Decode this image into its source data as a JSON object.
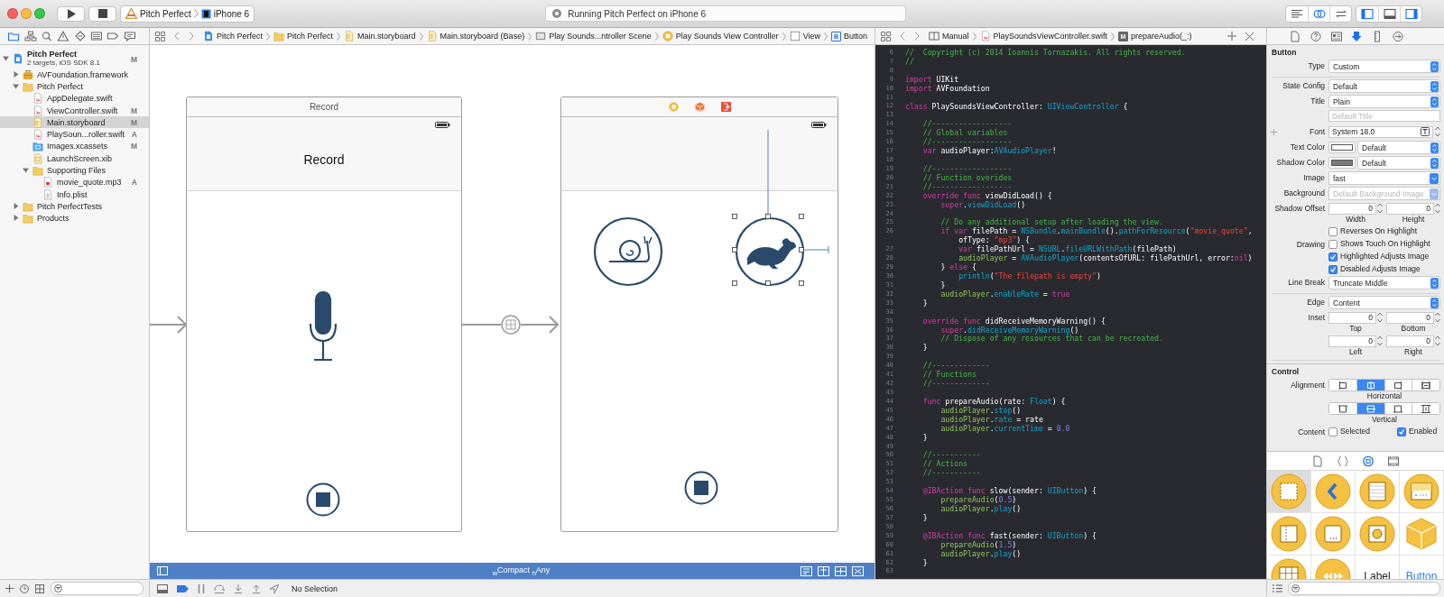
{
  "toolbar": {
    "scheme": {
      "target": "Pitch Perfect",
      "device": "iPhone 6"
    },
    "activity": "Running Pitch Perfect on iPhone 6",
    "editor_modes": [
      {
        "kind": "standard",
        "selected": false
      },
      {
        "kind": "assistant",
        "selected": true
      },
      {
        "kind": "version",
        "selected": false
      }
    ],
    "panels": [
      {
        "kind": "navigator",
        "on": true
      },
      {
        "kind": "debug",
        "on": false
      },
      {
        "kind": "utilities",
        "on": true
      }
    ]
  },
  "navigator": {
    "tabs": [
      {
        "kind": "project",
        "selected": true
      },
      {
        "kind": "symbols",
        "selected": false
      },
      {
        "kind": "search",
        "selected": false
      },
      {
        "kind": "issues",
        "selected": false
      },
      {
        "kind": "tests",
        "selected": false
      },
      {
        "kind": "debug",
        "selected": false
      },
      {
        "kind": "breakpoints",
        "selected": false
      },
      {
        "kind": "reports",
        "selected": false
      }
    ],
    "tree": [
      {
        "kind": "project",
        "name": "Pitch Perfect",
        "subtitle": "2 targets, iOS SDK 8.1",
        "badge": "M",
        "selected": false,
        "expanded": true,
        "children": [
          {
            "kind": "framework",
            "name": "AVFoundation.framework",
            "selected": false,
            "expanded": false
          },
          {
            "kind": "folder",
            "name": "Pitch Perfect",
            "selected": false,
            "expanded": true,
            "children": [
              {
                "kind": "swift",
                "name": "AppDelegate.swift",
                "selected": false
              },
              {
                "kind": "swift",
                "name": "ViewController.swift",
                "badge": "M",
                "selected": false
              },
              {
                "kind": "storyboard",
                "name": "Main.storyboard",
                "badge": "M",
                "selected": true
              },
              {
                "kind": "swift",
                "name": "PlaySoun...roller.swift",
                "badge": "A",
                "selected": false
              },
              {
                "kind": "assets",
                "name": "Images.xcassets",
                "badge": "M",
                "selected": false
              },
              {
                "kind": "xib",
                "name": "LaunchScreen.xib",
                "selected": false
              },
              {
                "kind": "folder",
                "name": "Supporting Files",
                "selected": false,
                "expanded": true,
                "children": [
                  {
                    "kind": "audio",
                    "name": "movie_quote.mp3",
                    "badge": "A",
                    "selected": false
                  },
                  {
                    "kind": "plist",
                    "name": "Info.plist",
                    "selected": false
                  }
                ]
              }
            ]
          },
          {
            "kind": "folder",
            "name": "Pitch PerfectTests",
            "selected": false,
            "expanded": false
          },
          {
            "kind": "folder",
            "name": "Products",
            "selected": false,
            "expanded": false
          }
        ]
      }
    ]
  },
  "jump_bar": {
    "crumbs": [
      {
        "kind": "project",
        "text": "Pitch Perfect"
      },
      {
        "kind": "folder",
        "text": "Pitch Perfect"
      },
      {
        "kind": "storyboard",
        "text": "Main.storyboard"
      },
      {
        "kind": "storyboard",
        "text": "Main.storyboard (Base)"
      },
      {
        "kind": "scene",
        "text": "Play Sounds...ntroller Scene"
      },
      {
        "kind": "controller",
        "text": "Play Sounds View Controller"
      },
      {
        "kind": "view",
        "text": "View"
      },
      {
        "kind": "letter",
        "icon_letter": "B",
        "text": "Button"
      }
    ]
  },
  "canvas": {
    "scenes": [
      {
        "kind": "record",
        "title": "Record",
        "nav_title": "Record",
        "buttons": [
          {
            "kind": "microphone",
            "selected": false
          },
          {
            "kind": "stop",
            "selected": false
          }
        ]
      },
      {
        "kind": "play",
        "buttons": [
          {
            "kind": "snail",
            "selected": false
          },
          {
            "kind": "rabbit",
            "selected": true
          },
          {
            "kind": "stop",
            "selected": false
          }
        ]
      }
    ],
    "size_class": "$_{w}$Compact $_{h}$Any"
  },
  "assistant": {
    "crumbs": [
      {
        "kind": "split",
        "text": "Manual"
      },
      {
        "kind": "swift",
        "text": "PlaySoundsViewController.swift"
      },
      {
        "kind": "letter",
        "icon_letter": "M",
        "text": "prepareAudio(_:)"
      }
    ],
    "code": [
      {
        "number": "6",
        "segments": [
          {
            "kind": "comment",
            "text": "//  Copyright (c) 2014 Ioannis Tornazakis. All rights reserved."
          }
        ]
      },
      {
        "number": "7",
        "segments": [
          {
            "kind": "comment",
            "text": "//"
          }
        ]
      },
      {
        "number": "8"
      },
      {
        "number": "9",
        "segments": [
          {
            "kind": "keyword",
            "text": "import"
          },
          {
            "kind": "plain",
            "text": " UIKit"
          }
        ]
      },
      {
        "number": "10",
        "segments": [
          {
            "kind": "keyword",
            "text": "import"
          },
          {
            "kind": "plain",
            "text": " AVFoundation"
          }
        ]
      },
      {
        "number": "11"
      },
      {
        "number": "12",
        "segments": [
          {
            "kind": "keyword",
            "text": "class"
          },
          {
            "kind": "plain",
            "text": " PlaySoundsViewController: "
          },
          {
            "kind": "api",
            "text": "UIViewController"
          },
          {
            "kind": "plain",
            "text": " {"
          }
        ]
      },
      {
        "number": "13"
      },
      {
        "number": "14",
        "segments": [
          {
            "kind": "comment",
            "text": "    //------------------"
          }
        ]
      },
      {
        "number": "15",
        "segments": [
          {
            "kind": "comment",
            "text": "    // Global variables"
          }
        ]
      },
      {
        "number": "16",
        "segments": [
          {
            "kind": "comment",
            "text": "    //------------------"
          }
        ]
      },
      {
        "number": "17",
        "segments": [
          {
            "kind": "keyword",
            "text": "    var"
          },
          {
            "kind": "plain",
            "text": " audioPlayer:"
          },
          {
            "kind": "api",
            "text": "AVAudioPlayer"
          },
          {
            "kind": "plain",
            "text": "!"
          }
        ]
      },
      {
        "number": "18"
      },
      {
        "number": "19",
        "segments": [
          {
            "kind": "comment",
            "text": "    //------------------"
          }
        ]
      },
      {
        "number": "20",
        "segments": [
          {
            "kind": "comment",
            "text": "    // Function overides"
          }
        ]
      },
      {
        "number": "21",
        "segments": [
          {
            "kind": "comment",
            "text": "    //------------------"
          }
        ]
      },
      {
        "number": "22",
        "segments": [
          {
            "kind": "keyword",
            "text": "    override func"
          },
          {
            "kind": "plain",
            "text": " viewDidLoad() {"
          }
        ]
      },
      {
        "number": "23",
        "segments": [
          {
            "kind": "keyword",
            "text": "        super"
          },
          {
            "kind": "plain",
            "text": "."
          },
          {
            "kind": "api",
            "text": "viewDidLoad"
          },
          {
            "kind": "plain",
            "text": "()"
          }
        ]
      },
      {
        "number": "24"
      },
      {
        "number": "25",
        "segments": [
          {
            "kind": "comment",
            "text": "        // Do any additional setup after loading the view."
          }
        ]
      },
      {
        "number": "26",
        "segments": [
          {
            "kind": "keyword",
            "text": "        if var"
          },
          {
            "kind": "plain",
            "text": " filePath = "
          },
          {
            "kind": "api",
            "text": "NSBundle"
          },
          {
            "kind": "plain",
            "text": "."
          },
          {
            "kind": "api",
            "text": "mainBundle"
          },
          {
            "kind": "plain",
            "text": "()."
          },
          {
            "kind": "api",
            "text": "pathForResource"
          },
          {
            "kind": "plain",
            "text": "("
          },
          {
            "kind": "string",
            "text": "\"movie_quote\""
          },
          {
            "kind": "plain",
            "text": ","
          }
        ]
      },
      {
        "segments": [
          {
            "kind": "plain",
            "text": "            ofType: "
          },
          {
            "kind": "string",
            "text": "\"mp3\""
          },
          {
            "kind": "plain",
            "text": ") {"
          }
        ]
      },
      {
        "number": "27",
        "segments": [
          {
            "kind": "keyword",
            "text": "            var"
          },
          {
            "kind": "plain",
            "text": " filePathUrl = "
          },
          {
            "kind": "api",
            "text": "NSURL"
          },
          {
            "kind": "plain",
            "text": "."
          },
          {
            "kind": "api",
            "text": "fileURLWithPath"
          },
          {
            "kind": "plain",
            "text": "(filePath)"
          }
        ]
      },
      {
        "number": "28",
        "segments": [
          {
            "kind": "project",
            "text": "            audioPlayer"
          },
          {
            "kind": "plain",
            "text": " = "
          },
          {
            "kind": "api",
            "text": "AVAudioPlayer"
          },
          {
            "kind": "plain",
            "text": "(contentsOfURL: filePathUrl, error:"
          },
          {
            "kind": "keyword",
            "text": "nil"
          },
          {
            "kind": "plain",
            "text": ")"
          }
        ]
      },
      {
        "number": "29",
        "segments": [
          {
            "kind": "plain",
            "text": "        } "
          },
          {
            "kind": "keyword",
            "text": "else"
          },
          {
            "kind": "plain",
            "text": " {"
          }
        ]
      },
      {
        "number": "30",
        "segments": [
          {
            "kind": "api",
            "text": "            println"
          },
          {
            "kind": "plain",
            "text": "("
          },
          {
            "kind": "string",
            "text": "\"The filepath is empty\""
          },
          {
            "kind": "plain",
            "text": ")"
          }
        ]
      },
      {
        "number": "31",
        "segments": [
          {
            "kind": "plain",
            "text": "        }"
          }
        ]
      },
      {
        "number": "32",
        "segments": [
          {
            "kind": "project",
            "text": "        audioPlayer"
          },
          {
            "kind": "plain",
            "text": "."
          },
          {
            "kind": "api",
            "text": "enableRate"
          },
          {
            "kind": "plain",
            "text": " = "
          },
          {
            "kind": "keyword",
            "text": "true"
          }
        ]
      },
      {
        "number": "33",
        "segments": [
          {
            "kind": "plain",
            "text": "    }"
          }
        ]
      },
      {
        "number": "34"
      },
      {
        "number": "35",
        "segments": [
          {
            "kind": "keyword",
            "text": "    override func"
          },
          {
            "kind": "plain",
            "text": " didReceiveMemoryWarning() {"
          }
        ]
      },
      {
        "number": "36",
        "segments": [
          {
            "kind": "keyword",
            "text": "        super"
          },
          {
            "kind": "plain",
            "text": "."
          },
          {
            "kind": "api",
            "text": "didReceiveMemoryWarning"
          },
          {
            "kind": "plain",
            "text": "()"
          }
        ]
      },
      {
        "number": "37",
        "segments": [
          {
            "kind": "comment",
            "text": "        // Dispose of any resources that can be recreated."
          }
        ]
      },
      {
        "number": "38",
        "segments": [
          {
            "kind": "plain",
            "text": "    }"
          }
        ]
      },
      {
        "number": "39"
      },
      {
        "number": "40",
        "segments": [
          {
            "kind": "comment",
            "text": "    //-------------"
          }
        ]
      },
      {
        "number": "41",
        "segments": [
          {
            "kind": "comment",
            "text": "    // Functions"
          }
        ]
      },
      {
        "number": "42",
        "segments": [
          {
            "kind": "comment",
            "text": "    //-------------"
          }
        ]
      },
      {
        "number": "43"
      },
      {
        "number": "44",
        "segments": [
          {
            "kind": "keyword",
            "text": "    func"
          },
          {
            "kind": "plain",
            "text": " prepareAudio(rate: "
          },
          {
            "kind": "api",
            "text": "Float"
          },
          {
            "kind": "plain",
            "text": ") {"
          }
        ]
      },
      {
        "number": "45",
        "segments": [
          {
            "kind": "project",
            "text": "        audioPlayer"
          },
          {
            "kind": "plain",
            "text": "."
          },
          {
            "kind": "api",
            "text": "stop"
          },
          {
            "kind": "plain",
            "text": "()"
          }
        ]
      },
      {
        "number": "46",
        "segments": [
          {
            "kind": "project",
            "text": "        audioPlayer"
          },
          {
            "kind": "plain",
            "text": "."
          },
          {
            "kind": "api",
            "text": "rate"
          },
          {
            "kind": "plain",
            "text": " = rate"
          }
        ]
      },
      {
        "number": "47",
        "segments": [
          {
            "kind": "project",
            "text": "        audioPlayer"
          },
          {
            "kind": "plain",
            "text": "."
          },
          {
            "kind": "api",
            "text": "currentTime"
          },
          {
            "kind": "plain",
            "text": " = "
          },
          {
            "kind": "number",
            "text": "0.0"
          }
        ]
      },
      {
        "number": "48",
        "segments": [
          {
            "kind": "plain",
            "text": "    }"
          }
        ]
      },
      {
        "number": "49"
      },
      {
        "number": "50",
        "segments": [
          {
            "kind": "comment",
            "text": "    //-----------"
          }
        ]
      },
      {
        "number": "51",
        "segments": [
          {
            "kind": "comment",
            "text": "    // Actions"
          }
        ]
      },
      {
        "number": "52",
        "segments": [
          {
            "kind": "comment",
            "text": "    //-----------"
          }
        ]
      },
      {
        "number": "53"
      },
      {
        "number": "54",
        "segments": [
          {
            "kind": "keyword",
            "text": "    @IBAction func"
          },
          {
            "kind": "plain",
            "text": " slow(sender: "
          },
          {
            "kind": "api",
            "text": "UIButton"
          },
          {
            "kind": "plain",
            "text": ") {"
          }
        ]
      },
      {
        "number": "55",
        "segments": [
          {
            "kind": "project",
            "text": "        prepareAudio"
          },
          {
            "kind": "plain",
            "text": "("
          },
          {
            "kind": "number",
            "text": "0.5"
          },
          {
            "kind": "plain",
            "text": ")"
          }
        ]
      },
      {
        "number": "56",
        "segments": [
          {
            "kind": "project",
            "text": "        audioPlayer"
          },
          {
            "kind": "plain",
            "text": "."
          },
          {
            "kind": "api",
            "text": "play"
          },
          {
            "kind": "plain",
            "text": "()"
          }
        ]
      },
      {
        "number": "57",
        "segments": [
          {
            "kind": "plain",
            "text": "    }"
          }
        ]
      },
      {
        "number": "58"
      },
      {
        "number": "59",
        "segments": [
          {
            "kind": "keyword",
            "text": "    @IBAction func"
          },
          {
            "kind": "plain",
            "text": " fast(sender: "
          },
          {
            "kind": "api",
            "text": "UIButton"
          },
          {
            "kind": "plain",
            "text": ") {"
          }
        ]
      },
      {
        "number": "60",
        "segments": [
          {
            "kind": "project",
            "text": "        prepareAudio"
          },
          {
            "kind": "plain",
            "text": "("
          },
          {
            "kind": "number",
            "text": "1.5"
          },
          {
            "kind": "plain",
            "text": ")"
          }
        ]
      },
      {
        "number": "61",
        "segments": [
          {
            "kind": "project",
            "text": "        audioPlayer"
          },
          {
            "kind": "plain",
            "text": "."
          },
          {
            "kind": "api",
            "text": "play"
          },
          {
            "kind": "plain",
            "text": "()"
          }
        ]
      },
      {
        "number": "62",
        "segments": [
          {
            "kind": "plain",
            "text": "    }"
          }
        ]
      },
      {
        "number": "63"
      }
    ]
  },
  "inspector": {
    "tabs": [
      {
        "kind": "file",
        "selected": false
      },
      {
        "kind": "help",
        "selected": false
      },
      {
        "kind": "identity",
        "selected": false
      },
      {
        "kind": "attributes",
        "selected": true
      },
      {
        "kind": "size",
        "selected": false
      },
      {
        "kind": "connections",
        "selected": false
      }
    ],
    "title": "Button",
    "groups": [
      {
        "rows": [
          {
            "kind": "popup",
            "label": "Type",
            "value": "Custom"
          }
        ]
      },
      {
        "rows": [
          {
            "kind": "popup",
            "label": "State Config",
            "value": "Default"
          },
          {
            "kind": "popup",
            "label": "Title",
            "value": "Plain"
          },
          {
            "kind": "field",
            "placeholder": "Default Title"
          },
          {
            "kind": "font",
            "label": "Font",
            "value": "System 18.0"
          },
          {
            "kind": "color",
            "label": "Text Color",
            "color": "#ffffff",
            "value": "Default"
          },
          {
            "kind": "color",
            "label": "Shadow Color",
            "color": "#7a7a7a",
            "value": "Default"
          },
          {
            "kind": "combo",
            "label": "Image",
            "value": "fast"
          },
          {
            "kind": "combo",
            "label": "Background",
            "placeholder": "Default Background Image"
          },
          {
            "kind": "pair",
            "label": "Shadow Offset",
            "fields": [
              {
                "value": "0",
                "caption": "Width"
              },
              {
                "value": "0",
                "caption": "Height"
              }
            ]
          },
          {
            "kind": "checkbox",
            "text": "Reverses On Highlight",
            "checked": false
          },
          {
            "kind": "checkbox",
            "label": "Drawing",
            "text": "Shows Touch On Highlight",
            "checked": false
          },
          {
            "kind": "checkbox",
            "text": "Highlighted Adjusts Image",
            "checked": true
          },
          {
            "kind": "checkbox",
            "text": "Disabled Adjusts Image",
            "checked": true
          },
          {
            "kind": "popup",
            "label": "Line Break",
            "value": "Truncate Middle"
          }
        ]
      },
      {
        "rows": [
          {
            "kind": "popup",
            "label": "Edge",
            "value": "Content"
          },
          {
            "kind": "pair",
            "label": "Inset",
            "fields": [
              {
                "value": "0",
                "caption": "Top"
              },
              {
                "value": "0",
                "caption": "Bottom"
              }
            ]
          },
          {
            "kind": "pair",
            "fields": [
              {
                "value": "0",
                "caption": "Left"
              },
              {
                "value": "0",
                "caption": "Right"
              }
            ]
          }
        ]
      }
    ],
    "control": {
      "title": "Control",
      "label": "Alignment",
      "horizontal": {
        "caption": "Horizontal",
        "segments": [
          {
            "kind": "left",
            "selected": false
          },
          {
            "kind": "center",
            "selected": true
          },
          {
            "kind": "right",
            "selected": false
          },
          {
            "kind": "fill",
            "selected": false
          }
        ]
      },
      "vertical": {
        "caption": "Vertical",
        "segments": [
          {
            "kind": "top",
            "selected": false
          },
          {
            "kind": "center",
            "selected": true
          },
          {
            "kind": "bottom",
            "selected": false
          },
          {
            "kind": "fill",
            "selected": false
          }
        ]
      },
      "content": {
        "label": "Content",
        "options": [
          {
            "text": "Selected",
            "checked": false
          },
          {
            "text": "Enabled",
            "checked": true
          }
        ]
      }
    }
  },
  "library": {
    "tabs": [
      {
        "kind": "file",
        "selected": false
      },
      {
        "kind": "snippet",
        "selected": false
      },
      {
        "kind": "object",
        "selected": true
      },
      {
        "kind": "media",
        "selected": false
      }
    ],
    "items": [
      {
        "kind": "view-controller",
        "selected": true
      },
      {
        "kind": "navigation-controller",
        "selected": false
      },
      {
        "kind": "table-controller",
        "selected": false
      },
      {
        "kind": "tab-controller",
        "selected": false
      },
      {
        "kind": "split-controller",
        "selected": false
      },
      {
        "kind": "page-controller",
        "selected": false
      },
      {
        "kind": "glkit-controller",
        "selected": false
      },
      {
        "kind": "object",
        "selected": false
      },
      {
        "kind": "collection-controller",
        "selected": false
      },
      {
        "kind": "player-controller",
        "selected": false
      },
      {
        "kind": "label",
        "text": "Label",
        "selected": false
      },
      {
        "kind": "button",
        "text": "Button",
        "selected": false
      }
    ]
  },
  "debug_bar": {
    "status": "No Selection"
  }
}
